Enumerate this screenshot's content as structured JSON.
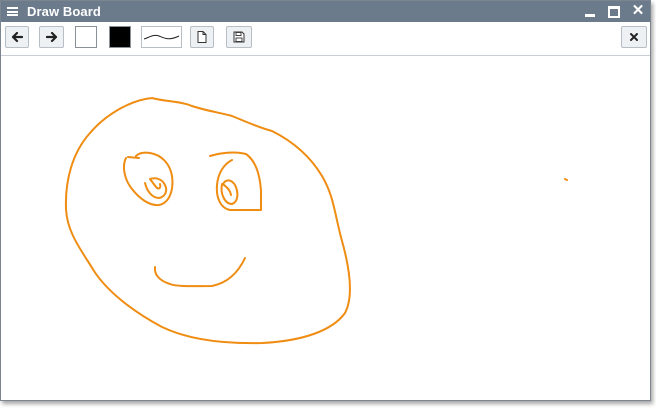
{
  "window": {
    "title": "Draw Board"
  },
  "titlebar": {
    "icons": [
      "menu-icon",
      "minimize-icon",
      "maximize-icon",
      "close-icon"
    ]
  },
  "toolbar": {
    "buttons": [
      "back-arrow-icon",
      "forward-arrow-icon",
      "new-document-icon",
      "save-floppy-icon",
      "close-icon"
    ],
    "fill_color": "#ffffff",
    "stroke_color": "#000000",
    "stroke_style": "curve"
  },
  "colors": {
    "titlebar": "#6b7b8c",
    "stroke": "#ef8c12"
  }
}
